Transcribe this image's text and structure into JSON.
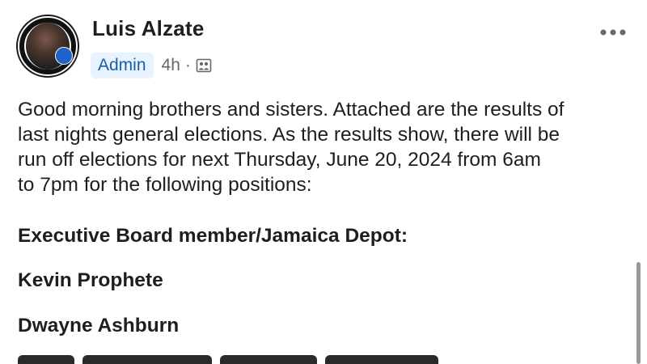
{
  "post": {
    "author": "Luis Alzate",
    "role_badge": "Admin",
    "timestamp": "4h",
    "separator": "·",
    "audience_icon": "group-members-icon",
    "more_icon": "more-dots-icon",
    "body": "Good morning brothers and sisters. Attached are the results of\nlast nights general elections. As the results show, there will be\nrun off elections for next Thursday, June 20, 2024 from 6am\nto 7pm for the following positions:",
    "section_heading": "Executive Board member/Jamaica Depot:",
    "candidates": [
      "Kevin Prophete",
      "Dwayne Ashburn"
    ]
  },
  "colors": {
    "admin_badge_bg": "#e7f3ff",
    "admin_badge_text": "#1b5ea8",
    "meta_gray": "#65676b",
    "text": "#1c1e21"
  }
}
